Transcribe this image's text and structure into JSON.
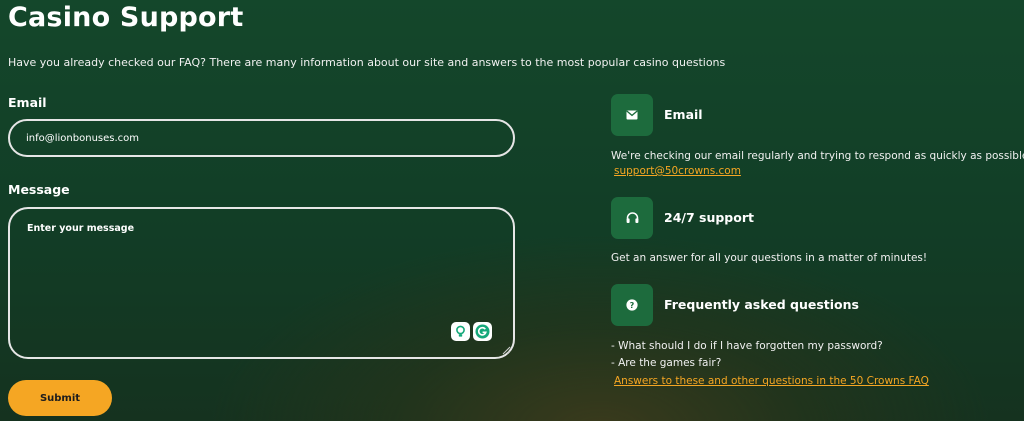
{
  "page": {
    "title": "Casino Support",
    "subtitle": "Have you already checked our FAQ? There are many information about our site and answers to the most popular casino questions"
  },
  "form": {
    "email_label": "Email",
    "email_value": "info@lionbonuses.com",
    "message_label": "Message",
    "message_placeholder": "Enter your message",
    "submit_label": "Submit"
  },
  "contact": {
    "email": {
      "icon": "envelope-icon",
      "title": "Email",
      "text": "We're checking our email regularly and trying to respond as quickly as possible.",
      "link": "support@50crowns.com"
    },
    "support": {
      "icon": "headset-icon",
      "title": "24/7 support",
      "text": "Get an answer for all your questions in a matter of minutes!"
    },
    "faq": {
      "icon": "question-icon",
      "title": "Frequently asked questions",
      "questions": [
        "- What should I do if I have forgotten my password?",
        "- Are the games fair?"
      ],
      "link": "Answers to these and other questions in the 50 Crowns FAQ"
    }
  },
  "colors": {
    "accent": "#f5a623",
    "icon_bg": "#1d6b3d",
    "background": "#14472b"
  }
}
